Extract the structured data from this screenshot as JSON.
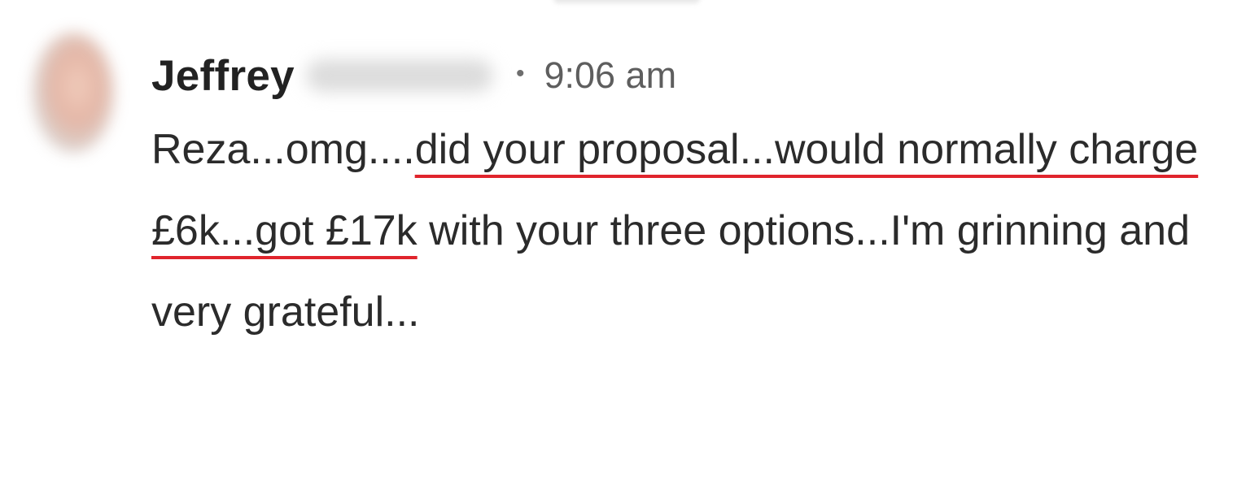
{
  "message": {
    "sender_name": "Jeffrey",
    "separator": "•",
    "timestamp": "9:06 am",
    "text_parts": [
      "Reza...omg....",
      "did your proposal...would normally charge £6k...got £17k",
      " with your three options...I'm grinning and very grateful..."
    ],
    "underline_color": "#e0242c"
  }
}
